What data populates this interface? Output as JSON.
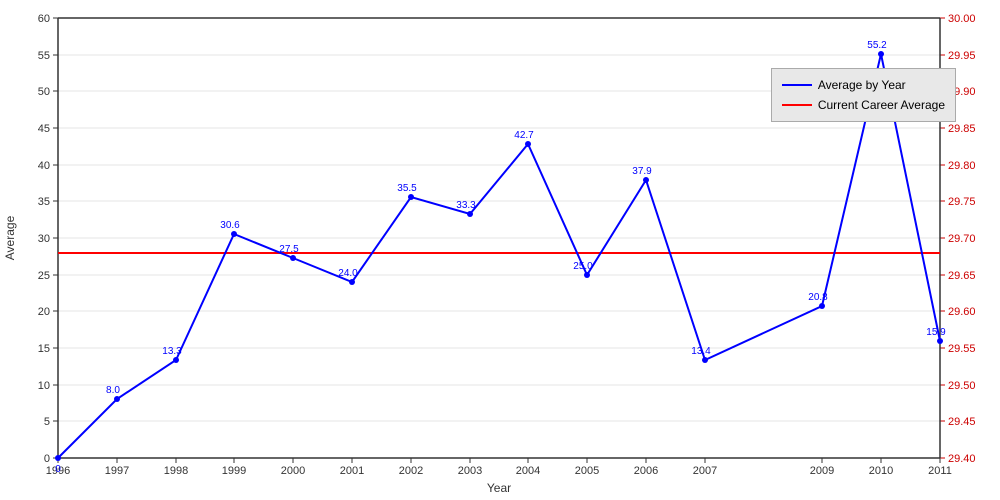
{
  "chart": {
    "title": "Average by Year",
    "xAxisLabel": "Year",
    "yAxisLeftLabel": "Average",
    "yAxisRightLabel": "",
    "leftYMin": 0,
    "leftYMax": 60,
    "rightYMin": 29.4,
    "rightYMax": 30.0,
    "careerAverage": 28.0,
    "dataPoints": [
      {
        "year": 1996,
        "value": 0.0,
        "label": "0"
      },
      {
        "year": 1997,
        "value": 8.0,
        "label": "8.0"
      },
      {
        "year": 1998,
        "value": 13.3,
        "label": "13.3"
      },
      {
        "year": 1999,
        "value": 30.6,
        "label": "30.6"
      },
      {
        "year": 2000,
        "value": 27.5,
        "label": "27.5"
      },
      {
        "year": 2001,
        "value": 24.0,
        "label": "24.0"
      },
      {
        "year": 2002,
        "value": 35.5,
        "label": "35.5"
      },
      {
        "year": 2003,
        "value": 33.3,
        "label": "33.3"
      },
      {
        "year": 2004,
        "value": 42.7,
        "label": "42.7"
      },
      {
        "year": 2005,
        "value": 25.0,
        "label": "25.0"
      },
      {
        "year": 2006,
        "value": 37.9,
        "label": "37.9"
      },
      {
        "year": 2007,
        "value": 13.4,
        "label": "13.4"
      },
      {
        "year": 2009,
        "value": 20.8,
        "label": "20.8"
      },
      {
        "year": 2010,
        "value": 55.2,
        "label": "55.2"
      },
      {
        "year": 2011,
        "value": 15.9,
        "label": "15.9"
      }
    ],
    "xTicks": [
      1996,
      1997,
      1998,
      1999,
      2000,
      2001,
      2002,
      2003,
      2004,
      2005,
      2006,
      2007,
      2009,
      2010,
      2011
    ],
    "leftYTicks": [
      0,
      5,
      10,
      15,
      20,
      25,
      30,
      35,
      40,
      45,
      50,
      55,
      60
    ],
    "rightYTicks": [
      29.4,
      29.45,
      29.5,
      29.55,
      29.6,
      29.65,
      29.7,
      29.75,
      29.8,
      29.85,
      29.9,
      29.95,
      30.0
    ]
  },
  "legend": {
    "series1": "Average by Year",
    "series2": "Current Career Average"
  }
}
